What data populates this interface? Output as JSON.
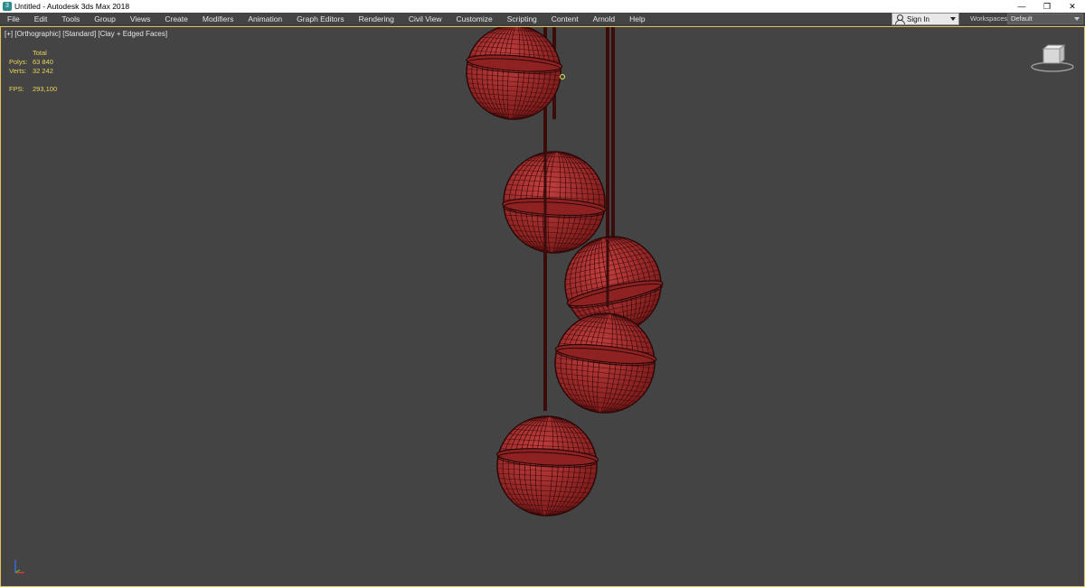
{
  "window": {
    "title": "Untitled - Autodesk 3ds Max 2018",
    "app_icon_glyph": "3",
    "controls": {
      "minimize": "—",
      "restore": "❐",
      "close": "✕"
    }
  },
  "menu": {
    "items": [
      "File",
      "Edit",
      "Tools",
      "Group",
      "Views",
      "Create",
      "Modifiers",
      "Animation",
      "Graph Editors",
      "Rendering",
      "Civil View",
      "Customize",
      "Scripting",
      "Content",
      "Arnold",
      "Help"
    ],
    "signin_label": "Sign In",
    "workspaces_label": "Workspaces:",
    "workspaces_value": "Default"
  },
  "viewport": {
    "label": "[+] [Orthographic] [Standard] [Clay + Edged Faces]",
    "stats": {
      "header": "Total",
      "polys_label": "Polys:",
      "polys_value": "63 840",
      "verts_label": "Verts:",
      "verts_value": "32 242",
      "fps_label": "FPS:",
      "fps_value": "293,100"
    }
  },
  "colors": {
    "viewport_bg": "#444444",
    "sphere_fill": "#a52a2a",
    "wire": "#3a0a0a",
    "stats_text": "#e8d35a",
    "active_border": "#e3c15b"
  }
}
